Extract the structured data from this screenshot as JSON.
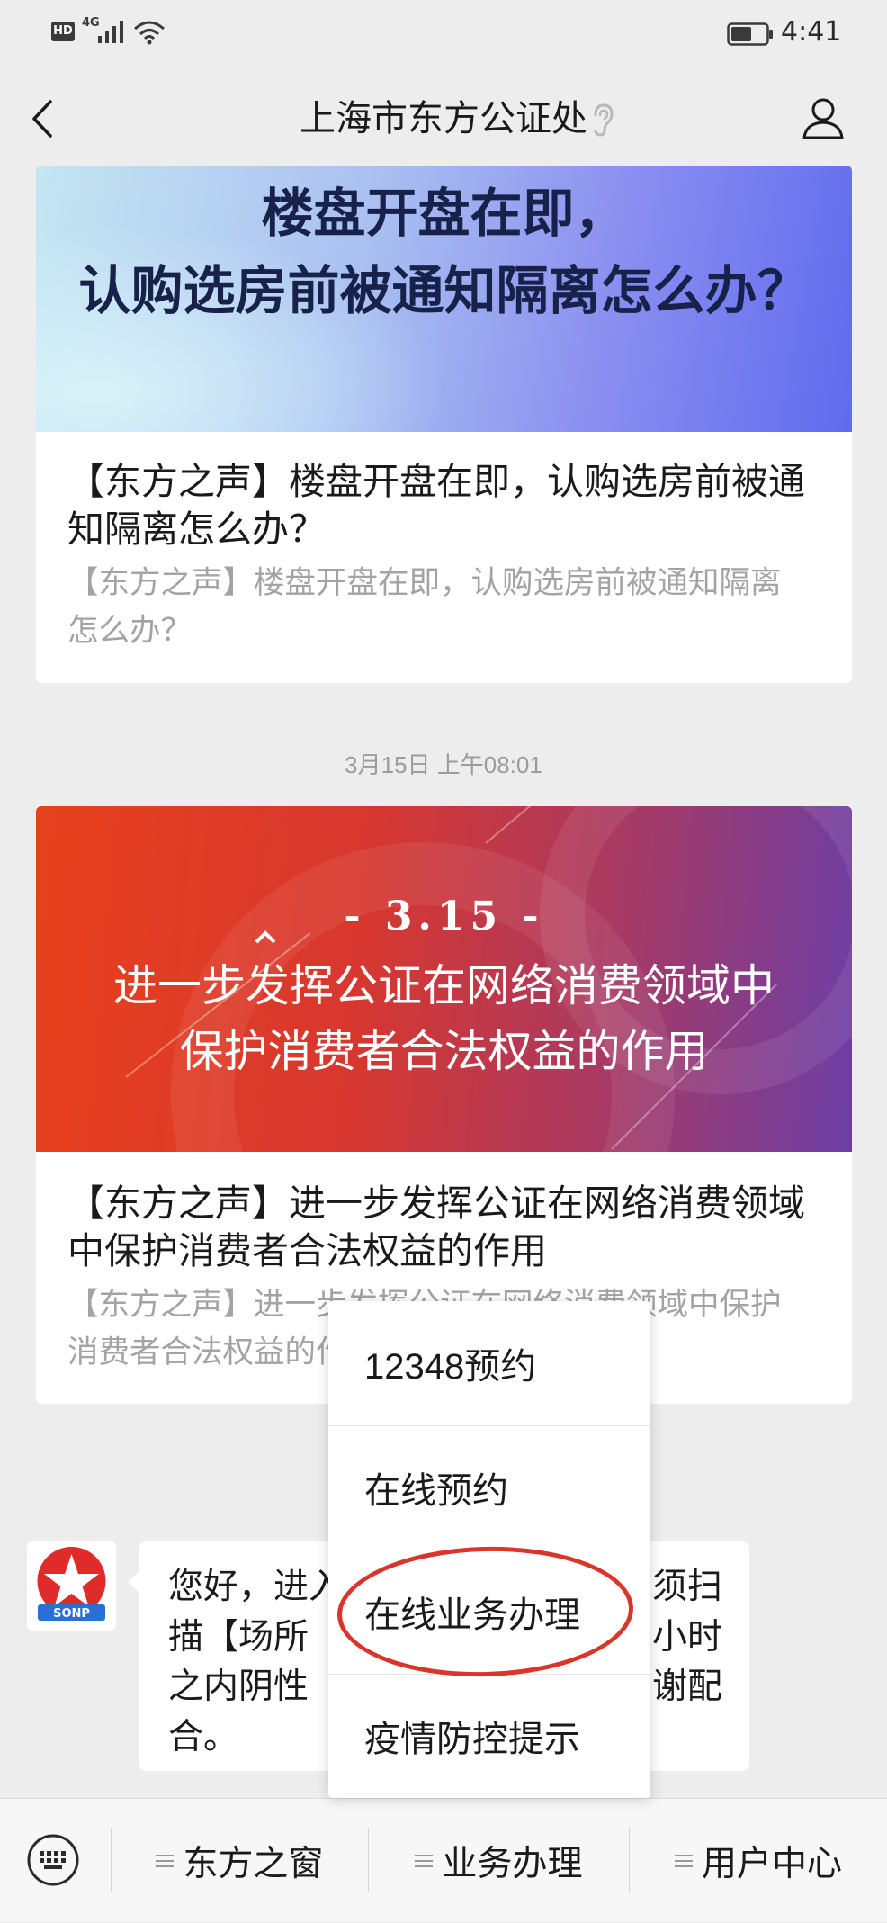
{
  "status_bar": {
    "hd_label": "HD",
    "network_label": "4G",
    "time": "4:41",
    "icons": [
      "signal-icon",
      "wifi-icon",
      "battery-icon"
    ]
  },
  "header": {
    "title": "上海市东方公证处",
    "icons": [
      "chevron-left-icon",
      "ear-icon",
      "person-icon"
    ]
  },
  "feed": {
    "article1": {
      "banner_lines": [
        "楼盘开盘在即，",
        "认购选房前被通知隔离怎么办？"
      ],
      "title": "【东方之声】楼盘开盘在即，认购选房前被通知隔离怎么办？",
      "description": "【东方之声】楼盘开盘在即，认购选房前被通知隔离怎么办？"
    },
    "timestamp": "3月15日 上午08:01",
    "article2": {
      "banner_tag": "- 3.15 -",
      "banner_lines": [
        "进一步发挥公证在网络消费领域中",
        "保护消费者合法权益的作用"
      ],
      "title": "【东方之声】进一步发挥公证在网络消费领域中保护消费者合法权益的作用",
      "description": "【东方之声】进一步发挥公证在网络消费领域中保护消费者合法权益的作用"
    }
  },
  "chat": {
    "avatar_logo_text": "SONP",
    "message_left_lines": [
      "您好，进入",
      "描【场所",
      "之内阴性",
      "合。"
    ],
    "message_right_lines": [
      "须扫",
      "小时",
      "谢配"
    ]
  },
  "popup_menu": {
    "items": [
      "12348预约",
      "在线预约",
      "在线业务办理",
      "疫情防控提示"
    ],
    "highlighted_index": 2
  },
  "bottom_bar": {
    "keyboard_icon": "keyboard-icon",
    "items": [
      {
        "icon": "menu-lines-icon",
        "label": "东方之窗"
      },
      {
        "icon": "menu-lines-icon",
        "label": "业务办理"
      },
      {
        "icon": "menu-lines-icon",
        "label": "用户中心"
      }
    ]
  },
  "colors": {
    "page_bg": "#ededed",
    "highlight_ring": "#d9352b",
    "banner2_start": "#e8411d",
    "banner2_end": "#6c3ea6",
    "logo_red": "#e02b2b",
    "logo_blue": "#2a6fd6"
  }
}
